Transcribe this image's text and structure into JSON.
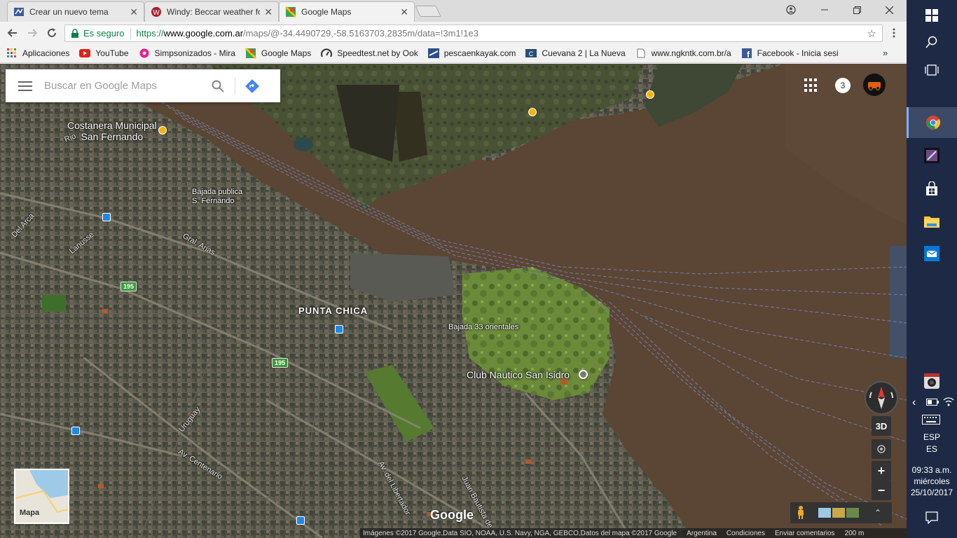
{
  "browser": {
    "tabs": [
      {
        "title": "Crear un nuevo tema",
        "favicon": "forum-icon"
      },
      {
        "title": "Windy: Beccar weather fo",
        "favicon": "windy-icon"
      },
      {
        "title": "Google Maps",
        "favicon": "google-maps-icon"
      }
    ],
    "omnibox": {
      "secure_label": "Es seguro",
      "url_proto": "https://",
      "url_host": "www.google.com.ar",
      "url_path": "/maps/@-34.4490729,-58.5163703,2835m/data=!3m1!1e3"
    },
    "bookmarks": [
      {
        "label": "Aplicaciones",
        "icon": "apps-icon"
      },
      {
        "label": "YouTube",
        "icon": "youtube-icon"
      },
      {
        "label": "Simpsonizados - Mira",
        "icon": "donut-icon"
      },
      {
        "label": "Google Maps",
        "icon": "google-maps-icon"
      },
      {
        "label": "Speedtest.net by Ook",
        "icon": "speedtest-icon"
      },
      {
        "label": "pescaenkayak.com",
        "icon": "kayak-icon"
      },
      {
        "label": "Cuevana 2 | La Nueva",
        "icon": "cuevana-icon"
      },
      {
        "label": "www.ngkntk.com.br/a",
        "icon": "page-icon"
      },
      {
        "label": "Facebook - Inicia sesi",
        "icon": "facebook-icon"
      }
    ]
  },
  "maps": {
    "search_placeholder": "Buscar en Google Maps",
    "notifications": "3",
    "labels": {
      "costanera_1": "Costanera Municipal",
      "costanera_2": "San Fernando",
      "bajada_publica_1": "Bajada publica",
      "bajada_publica_2": "S. Fernando",
      "punta_chica": "PUNTA CHICA",
      "bajada_33": "Bajada 33 orientales",
      "club_nautico": "Club Nautico San Isidro",
      "del_arca": "Del Arca",
      "lanusse": "Lanusse",
      "gral_arias": "Gral. Arias",
      "uruguay": "Uruguay",
      "av_centenario": "Av. Centenario",
      "av_libertador": "Av. del Libertador",
      "juan_bautista": "Juan Bautista de",
      "rio": "Rio",
      "ruta_195_a": "195",
      "ruta_195_b": "195"
    },
    "controls": {
      "three_d": "3D",
      "zoom_in": "+",
      "zoom_out": "−"
    },
    "minimap_label": "Mapa",
    "google_logo": "Google",
    "footer": {
      "attribution": "Imágenes ©2017 Google,Data SIO, NOAA, U.S. Navy, NGA, GEBCO,Datos del mapa ©2017 Google",
      "country": "Argentina",
      "terms": "Condiciones",
      "feedback": "Enviar comentarios",
      "scale": "200 m"
    }
  },
  "taskbar": {
    "lang_1": "ESP",
    "lang_2": "ES",
    "time": "09:33 a.m.",
    "day": "miércoles",
    "date": "25/10/2017"
  },
  "colors": {
    "water": "#5b4535",
    "land": "#4a4a3c",
    "taskbar": "#1e2a45",
    "secure_green": "#0b8043"
  }
}
